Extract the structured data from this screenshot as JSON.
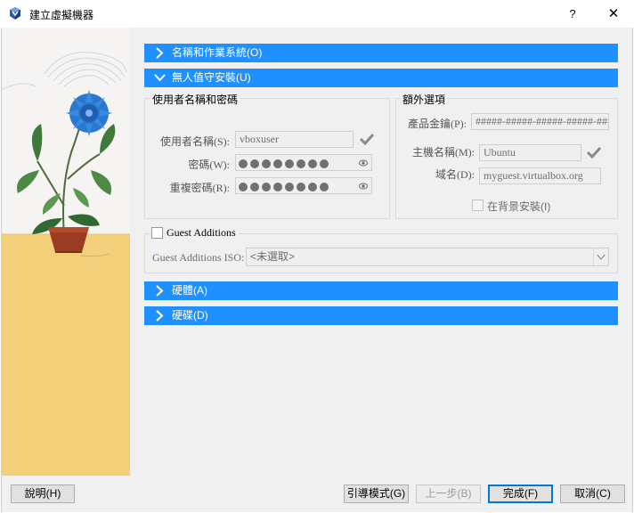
{
  "window": {
    "title": "建立虛擬機器",
    "help_glyph": "?",
    "close_glyph": "✕"
  },
  "sections": {
    "name_os": "名稱和作業系統(O)",
    "unattended": "無人值守安裝(U)",
    "hardware": "硬體(A)",
    "disk": "硬碟(D)"
  },
  "user_group": {
    "title": "使用者名稱和密碼",
    "username_label": "使用者名稱(S):",
    "username_value": "vboxuser",
    "password_label": "密碼(W):",
    "repeat_label": "重複密碼(R):"
  },
  "extra_group": {
    "title": "額外選項",
    "product_key_label": "產品金鑰(P):",
    "product_key_value": "#####-#####-#####-#####-#####",
    "hostname_label": "主機名稱(M):",
    "hostname_value": "Ubuntu",
    "domain_label": "域名(D):",
    "domain_value": "myguest.virtualbox.org",
    "background_label": "在背景安裝(I)"
  },
  "guest_additions": {
    "checkbox_label": "Guest Additions",
    "iso_label": "Guest Additions ISO:",
    "iso_value": "<未選取>"
  },
  "buttons": {
    "help": "說明(H)",
    "guided": "引導模式(G)",
    "back": "上一步(B)",
    "finish": "完成(F)",
    "cancel": "取消(C)"
  },
  "colors": {
    "section_bar": "#1e90ff",
    "default_button_border": "#0078d7"
  },
  "icons": {
    "app": "virtualbox-icon",
    "valid": "checkmark-icon",
    "reveal": "eye-icon",
    "expand": "chevron-right-icon",
    "collapse": "chevron-down-icon"
  }
}
